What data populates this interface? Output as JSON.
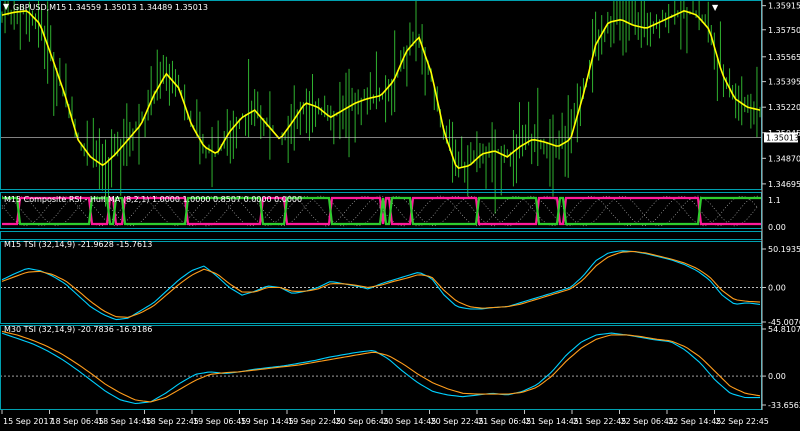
{
  "main": {
    "symbol": "GBPUSD,M15",
    "ohlc": "1.34559 1.35013 1.34489 1.35013",
    "price_ticks": [
      "1.35915",
      "1.35750",
      "1.35565",
      "1.35395",
      "1.35220",
      "1.35045",
      "1.34870",
      "1.34695"
    ],
    "current_price": "1.35013",
    "colors": {
      "candles": "#2fb12f",
      "ma": "#ffff00",
      "axis": "#c8c8c8",
      "frame": "#00a0b0",
      "grid": "#cfcfcf"
    }
  },
  "crsi": {
    "title": "M15 Composite RSI - Hull MA (8,2,1) 1.0000 1.0000 0.8507 0.0000 0.0000",
    "ticks": [
      "1.1",
      "0.00"
    ],
    "colors": {
      "green": "#2ecc2e",
      "magenta": "#ff1a9a",
      "dots": "#c0c0c0"
    }
  },
  "tsi_m15": {
    "title": "M15 TSI (32,14,9) -21.9628 -15.7613",
    "ticks": [
      "50.1935",
      "0.00",
      "-45.0076"
    ],
    "colors": {
      "tsi": "#00d0ff",
      "signal": "#ff9d1c",
      "zero": "#ffffff"
    }
  },
  "tsi_m30": {
    "title": "M30 TSI (32,14,9) -20.7836 -16.9186",
    "ticks": [
      "54.8107",
      "0.00",
      "-33.6562"
    ],
    "colors": {
      "tsi": "#00d0ff",
      "signal": "#ff9d1c"
    }
  },
  "time_axis": [
    "15 Sep 2017",
    "18 Sep 06:45",
    "18 Sep 14:45",
    "18 Sep 22:45",
    "19 Sep 06:45",
    "19 Sep 14:45",
    "19 Sep 22:45",
    "20 Sep 06:45",
    "20 Sep 14:45",
    "20 Sep 22:45",
    "21 Sep 06:45",
    "21 Sep 14:45",
    "21 Sep 22:45",
    "22 Sep 06:45",
    "22 Sep 14:45",
    "22 Sep 22:45"
  ],
  "chart_data": [
    {
      "type": "candlestick",
      "title": "GBPUSD,M15",
      "ylim": [
        1.3466,
        1.3594
      ],
      "ma_series_y": [
        1.3585,
        1.3587,
        1.3588,
        1.3579,
        1.3555,
        1.353,
        1.35,
        1.3488,
        1.3482,
        1.349,
        1.35,
        1.351,
        1.353,
        1.3545,
        1.3535,
        1.351,
        1.3495,
        1.349,
        1.3505,
        1.3515,
        1.352,
        1.351,
        1.35,
        1.3512,
        1.3525,
        1.3522,
        1.3515,
        1.352,
        1.3525,
        1.3528,
        1.353,
        1.354,
        1.356,
        1.357,
        1.3545,
        1.3505,
        1.348,
        1.3482,
        1.349,
        1.3492,
        1.3488,
        1.3495,
        1.35,
        1.3498,
        1.3495,
        1.35,
        1.353,
        1.3565,
        1.358,
        1.3582,
        1.3578,
        1.3576,
        1.358,
        1.3584,
        1.3588,
        1.3585,
        1.3575,
        1.3545,
        1.3528,
        1.3522,
        1.352
      ]
    },
    {
      "type": "line",
      "title": "M15 TSI (32,14,9)",
      "ylim": [
        -45.0076,
        50.1935
      ],
      "series": [
        {
          "name": "TSI",
          "values": [
            10,
            18,
            25,
            22,
            15,
            5,
            -10,
            -25,
            -35,
            -42,
            -40,
            -30,
            -20,
            -5,
            10,
            22,
            28,
            15,
            0,
            -10,
            -5,
            2,
            0,
            -8,
            -5,
            0,
            8,
            5,
            2,
            -2,
            5,
            10,
            15,
            20,
            12,
            -10,
            -25,
            -28,
            -28,
            -26,
            -25,
            -20,
            -15,
            -10,
            -5,
            0,
            15,
            35,
            45,
            48,
            47,
            44,
            40,
            36,
            30,
            22,
            10,
            -10,
            -22,
            -20,
            -22
          ]
        },
        {
          "name": "Signal",
          "values": [
            8,
            14,
            20,
            21,
            17,
            9,
            -4,
            -18,
            -30,
            -38,
            -39,
            -33,
            -24,
            -10,
            4,
            16,
            24,
            18,
            5,
            -6,
            -6,
            0,
            0,
            -5,
            -5,
            -2,
            5,
            5,
            3,
            0,
            3,
            8,
            12,
            17,
            14,
            -4,
            -18,
            -25,
            -27,
            -26,
            -25,
            -22,
            -17,
            -12,
            -7,
            -2,
            10,
            28,
            40,
            46,
            47,
            45,
            41,
            37,
            32,
            25,
            14,
            -4,
            -16,
            -18,
            -19
          ]
        }
      ]
    },
    {
      "type": "line",
      "title": "M30 TSI (32,14,9)",
      "ylim": [
        -33.6562,
        54.8107
      ],
      "series": [
        {
          "name": "TSI",
          "values": [
            50,
            44,
            38,
            30,
            20,
            8,
            -5,
            -18,
            -28,
            -32,
            -30,
            -20,
            -8,
            2,
            5,
            3,
            5,
            8,
            10,
            12,
            15,
            18,
            22,
            25,
            28,
            30,
            20,
            5,
            -8,
            -18,
            -22,
            -24,
            -22,
            -20,
            -22,
            -18,
            -10,
            5,
            25,
            40,
            48,
            50,
            48,
            45,
            42,
            40,
            30,
            15,
            -5,
            -20,
            -25,
            -25
          ]
        },
        {
          "name": "Signal",
          "values": [
            52,
            48,
            42,
            35,
            26,
            15,
            3,
            -10,
            -20,
            -28,
            -30,
            -25,
            -15,
            -5,
            2,
            4,
            5,
            7,
            9,
            11,
            13,
            16,
            19,
            22,
            25,
            28,
            24,
            14,
            2,
            -8,
            -15,
            -20,
            -21,
            -21,
            -21,
            -19,
            -13,
            0,
            18,
            33,
            43,
            48,
            48,
            46,
            43,
            41,
            34,
            22,
            5,
            -12,
            -20,
            -23
          ]
        }
      ]
    }
  ]
}
